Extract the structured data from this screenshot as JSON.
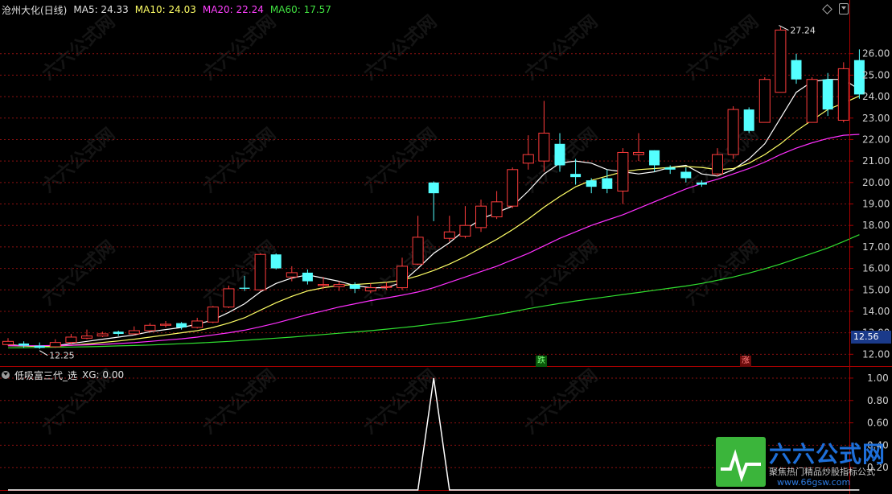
{
  "header": {
    "stock": "沧州大化(日线)",
    "ma5": "MA5: 24.33",
    "ma10": "MA10: 24.03",
    "ma20": "MA20: 22.24",
    "ma60": "MA60: 17.57"
  },
  "indicator": {
    "name": "低吸富三代_选",
    "value": "XG: 0.00"
  },
  "annotations": {
    "high_label": "27.24",
    "low_label": "12.25",
    "current_price": "12.56",
    "down_badge": "跌",
    "up_badge": "涨"
  },
  "watermark": {
    "logo_text": "六六公式网",
    "slogan": "聚焦热门精品炒股指标公式",
    "url": "www.66gsw.com",
    "faint_text": "六六公式网"
  },
  "colors": {
    "up": "#ff3c3c",
    "down": "#54ffff",
    "ma5": "#ffffff",
    "ma10": "#ffff66",
    "ma20": "#ff30ff",
    "ma60": "#30e030",
    "grid": "#8a1010",
    "axis": "#aa0000"
  },
  "chart_data": [
    {
      "type": "candlestick",
      "title": "沧州大化(日线)",
      "ylim": [
        11.6,
        27.6
      ],
      "yticks": [
        12,
        13,
        14,
        15,
        16,
        17,
        18,
        19,
        20,
        21,
        22,
        23,
        24,
        25,
        26
      ],
      "candles": [
        [
          12.45,
          12.6,
          12.75,
          12.4
        ],
        [
          12.5,
          12.4,
          12.6,
          12.3
        ],
        [
          12.4,
          12.3,
          12.55,
          12.25
        ],
        [
          12.35,
          12.55,
          12.7,
          12.3
        ],
        [
          12.55,
          12.8,
          12.95,
          12.45
        ],
        [
          12.75,
          12.85,
          13.15,
          12.7
        ],
        [
          12.85,
          12.95,
          13.05,
          12.8
        ],
        [
          13.05,
          12.95,
          13.1,
          12.85
        ],
        [
          12.95,
          13.1,
          13.3,
          12.9
        ],
        [
          13.1,
          13.35,
          13.45,
          13.05
        ],
        [
          13.35,
          13.4,
          13.55,
          13.25
        ],
        [
          13.45,
          13.25,
          13.5,
          13.15
        ],
        [
          13.25,
          13.55,
          13.7,
          13.2
        ],
        [
          13.5,
          14.2,
          14.25,
          13.45
        ],
        [
          14.2,
          15.05,
          15.2,
          14.15
        ],
        [
          15.1,
          15.05,
          15.65,
          14.95
        ],
        [
          15.0,
          16.65,
          16.7,
          14.95
        ],
        [
          16.65,
          16.0,
          16.7,
          15.95
        ],
        [
          15.6,
          15.8,
          16.1,
          15.4
        ],
        [
          15.8,
          15.4,
          15.95,
          15.25
        ],
        [
          15.2,
          15.25,
          15.6,
          15.05
        ],
        [
          15.15,
          15.25,
          15.4,
          14.95
        ],
        [
          15.25,
          15.05,
          15.35,
          14.85
        ],
        [
          14.95,
          15.1,
          15.3,
          14.85
        ],
        [
          15.15,
          15.15,
          15.35,
          15.0
        ],
        [
          15.1,
          16.1,
          16.5,
          15.0
        ],
        [
          16.2,
          17.45,
          18.45,
          16.15
        ],
        [
          20.0,
          19.5,
          20.05,
          18.2
        ],
        [
          17.4,
          17.7,
          18.45,
          17.25
        ],
        [
          17.5,
          18.0,
          18.9,
          17.4
        ],
        [
          17.9,
          18.9,
          19.2,
          17.7
        ],
        [
          18.4,
          19.1,
          19.6,
          18.3
        ],
        [
          18.9,
          20.6,
          20.7,
          18.8
        ],
        [
          20.9,
          21.3,
          22.2,
          20.6
        ],
        [
          21.0,
          22.3,
          23.8,
          20.5
        ],
        [
          21.8,
          20.8,
          22.3,
          20.5
        ],
        [
          20.4,
          20.25,
          21.1,
          19.9
        ],
        [
          20.1,
          19.8,
          20.2,
          19.5
        ],
        [
          20.2,
          19.7,
          20.6,
          19.5
        ],
        [
          19.6,
          21.4,
          21.6,
          19.0
        ],
        [
          21.3,
          21.4,
          22.3,
          21.0
        ],
        [
          21.5,
          20.8,
          21.5,
          20.5
        ],
        [
          20.7,
          20.6,
          20.8,
          20.4
        ],
        [
          20.5,
          20.2,
          20.7,
          20.0
        ],
        [
          20.0,
          19.9,
          20.1,
          19.8
        ],
        [
          20.4,
          21.3,
          21.6,
          20.3
        ],
        [
          21.3,
          23.4,
          23.55,
          21.1
        ],
        [
          23.4,
          22.4,
          23.5,
          22.3
        ],
        [
          22.8,
          24.8,
          24.9,
          22.8
        ],
        [
          24.2,
          27.1,
          27.24,
          24.2
        ],
        [
          25.7,
          24.8,
          26.0,
          24.6
        ],
        [
          22.8,
          24.8,
          24.9,
          22.8
        ],
        [
          24.8,
          23.4,
          25.1,
          23.1
        ],
        [
          22.9,
          25.3,
          25.6,
          22.8
        ],
        [
          25.7,
          24.1,
          26.2,
          23.9
        ]
      ],
      "ma": {
        "MA5": [
          12.45,
          12.4,
          12.35,
          12.4,
          12.5,
          12.6,
          12.7,
          12.8,
          12.9,
          13.05,
          13.15,
          13.25,
          13.4,
          13.6,
          13.95,
          14.35,
          14.9,
          15.3,
          15.55,
          15.7,
          15.55,
          15.4,
          15.2,
          15.1,
          15.1,
          15.35,
          16.0,
          16.7,
          17.2,
          17.8,
          18.3,
          18.6,
          18.9,
          19.6,
          20.4,
          20.9,
          21.0,
          20.9,
          20.6,
          20.5,
          20.4,
          20.5,
          20.7,
          20.8,
          20.4,
          20.3,
          20.6,
          21.1,
          21.8,
          23.0,
          24.2,
          24.7,
          24.8,
          24.8,
          24.33
        ],
        "MA10": [
          12.4,
          12.38,
          12.37,
          12.38,
          12.42,
          12.48,
          12.55,
          12.62,
          12.7,
          12.8,
          12.9,
          13.0,
          13.1,
          13.25,
          13.45,
          13.7,
          14.05,
          14.4,
          14.7,
          14.95,
          15.1,
          15.2,
          15.25,
          15.3,
          15.35,
          15.45,
          15.65,
          15.9,
          16.2,
          16.55,
          16.95,
          17.35,
          17.8,
          18.3,
          18.85,
          19.35,
          19.8,
          20.1,
          20.3,
          20.5,
          20.6,
          20.65,
          20.7,
          20.75,
          20.7,
          20.6,
          20.65,
          20.9,
          21.3,
          21.8,
          22.4,
          22.9,
          23.4,
          23.7,
          24.03
        ],
        "MA20": [
          12.4,
          12.4,
          12.4,
          12.41,
          12.42,
          12.44,
          12.46,
          12.5,
          12.54,
          12.6,
          12.66,
          12.72,
          12.8,
          12.9,
          13.0,
          13.12,
          13.28,
          13.45,
          13.65,
          13.85,
          14.02,
          14.2,
          14.35,
          14.5,
          14.62,
          14.75,
          14.9,
          15.1,
          15.35,
          15.6,
          15.85,
          16.1,
          16.4,
          16.7,
          17.05,
          17.4,
          17.7,
          18.0,
          18.25,
          18.5,
          18.8,
          19.1,
          19.4,
          19.7,
          19.95,
          20.15,
          20.4,
          20.65,
          20.95,
          21.3,
          21.6,
          21.85,
          22.05,
          22.2,
          22.24
        ],
        "MA60": [
          12.3,
          12.31,
          12.32,
          12.33,
          12.34,
          12.35,
          12.37,
          12.39,
          12.41,
          12.43,
          12.46,
          12.49,
          12.52,
          12.56,
          12.6,
          12.65,
          12.7,
          12.75,
          12.8,
          12.86,
          12.92,
          12.98,
          13.04,
          13.1,
          13.17,
          13.24,
          13.32,
          13.41,
          13.5,
          13.6,
          13.72,
          13.85,
          13.98,
          14.12,
          14.25,
          14.37,
          14.48,
          14.58,
          14.68,
          14.78,
          14.88,
          14.98,
          15.08,
          15.18,
          15.3,
          15.45,
          15.6,
          15.78,
          15.98,
          16.2,
          16.45,
          16.7,
          16.95,
          17.25,
          17.57
        ]
      },
      "high_marker": {
        "value": 27.24,
        "index": 49
      },
      "low_marker": {
        "value": 12.25,
        "index": 2
      }
    },
    {
      "type": "line",
      "title": "低吸富三代_选",
      "ylim": [
        0,
        1.05
      ],
      "yticks": [
        0.2,
        0.4,
        0.6,
        0.8,
        1.0
      ],
      "series": [
        {
          "name": "XG",
          "x": [
            0,
            26,
            27,
            28,
            54
          ],
          "values": [
            0,
            0,
            1,
            0,
            0
          ]
        }
      ]
    }
  ]
}
